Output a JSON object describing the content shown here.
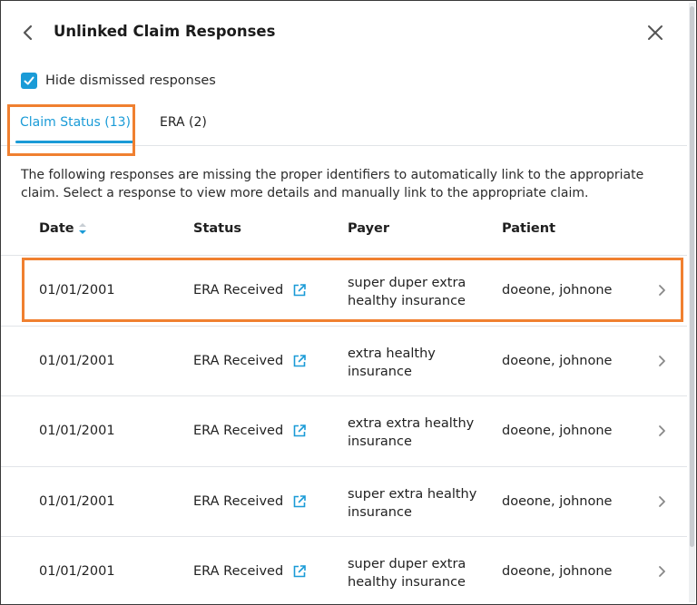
{
  "header": {
    "title": "Unlinked Claim Responses",
    "back_icon": "chevron-left-icon",
    "close_icon": "close-icon"
  },
  "filter": {
    "hide_dismissed_label": "Hide dismissed responses",
    "hide_dismissed_checked": true
  },
  "tabs": [
    {
      "label": "Claim Status (13)",
      "active": true
    },
    {
      "label": "ERA (2)",
      "active": false
    }
  ],
  "description": "The following responses are missing the proper identifiers to automatically link to the appropriate claim. Select a response to view more details and manually link to the appropriate claim.",
  "table": {
    "columns": [
      "Date",
      "Status",
      "Payer",
      "Patient"
    ],
    "sort_column": "Date",
    "rows": [
      {
        "date": "01/01/2001",
        "status": "ERA Received",
        "payer": "super duper extra healthy insurance",
        "patient": "doeone, johnone"
      },
      {
        "date": "01/01/2001",
        "status": "ERA Received",
        "payer": "extra healthy insurance",
        "patient": "doeone, johnone"
      },
      {
        "date": "01/01/2001",
        "status": "ERA Received",
        "payer": "extra extra healthy insurance",
        "patient": "doeone, johnone"
      },
      {
        "date": "01/01/2001",
        "status": "ERA Received",
        "payer": "super extra healthy insurance",
        "patient": "doeone, johnone"
      },
      {
        "date": "01/01/2001",
        "status": "ERA Received",
        "payer": "super duper extra healthy insurance",
        "patient": "doeone, johnone"
      }
    ]
  },
  "colors": {
    "accent": "#1a9bd7",
    "highlight": "#f08030",
    "divider": "#e1e4e8"
  }
}
